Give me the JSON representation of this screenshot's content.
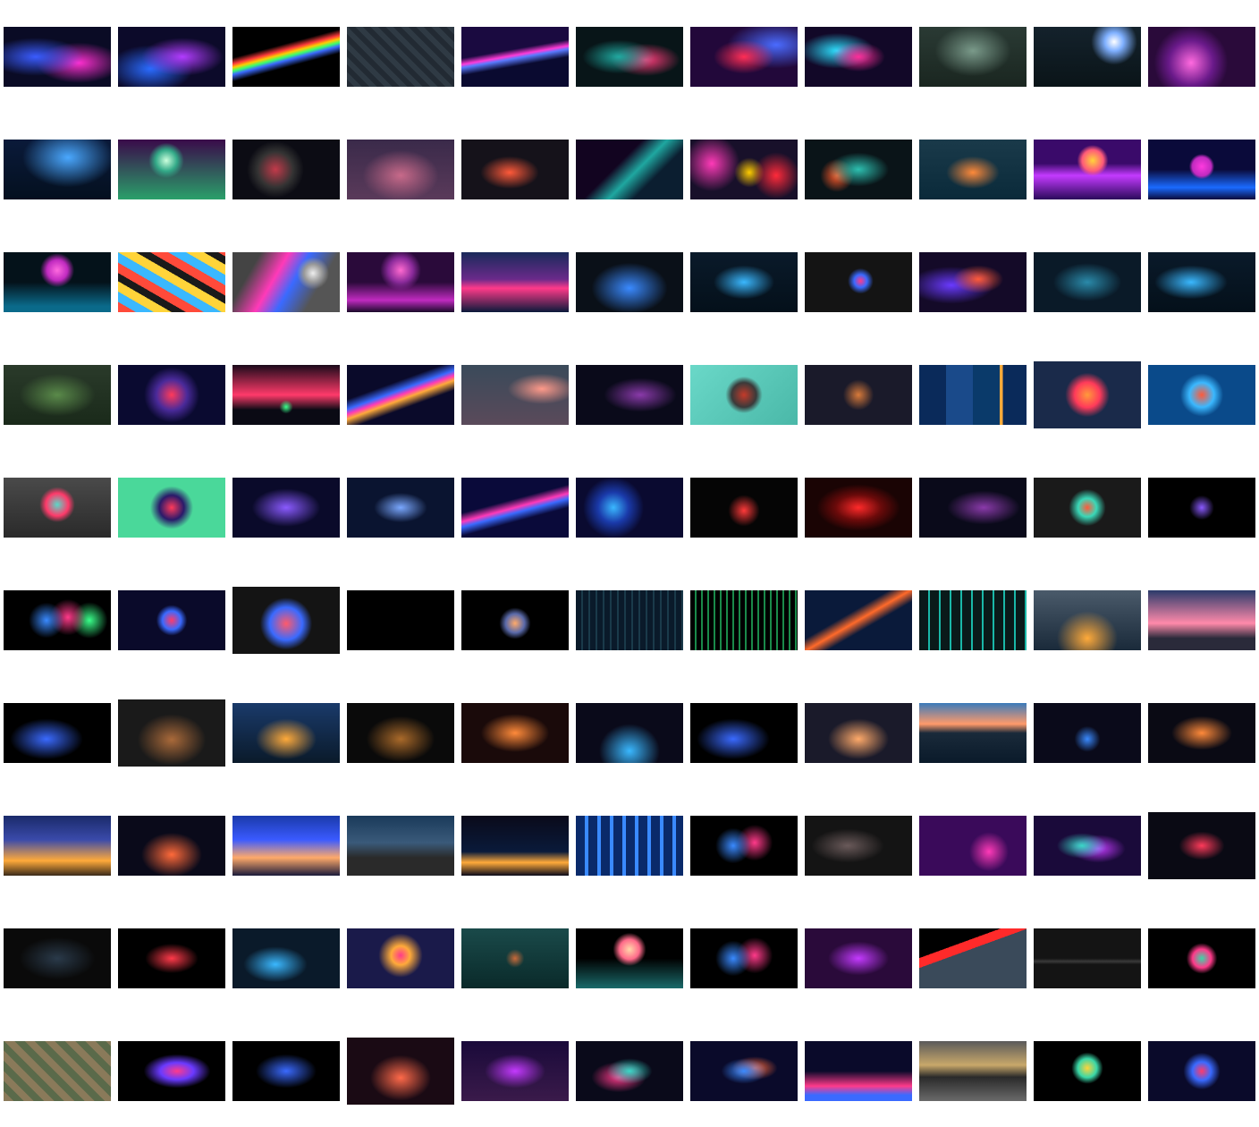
{
  "gallery": {
    "rows": [
      [
        {
          "bg": "radial-gradient(ellipse at 30% 50%, #3a5cff 0%, transparent 45%), radial-gradient(ellipse at 70% 60%, #ff2fd0 0%, transparent 40%), #0a0b25"
        },
        {
          "bg": "radial-gradient(ellipse at 60% 50%, #b23cff 0%, transparent 45%), radial-gradient(ellipse at 30% 70%, #2a6bff 0%, transparent 40%), #0c0a2a"
        },
        {
          "bg": "linear-gradient(165deg, #000 35%, #ff3b3b 42%, #ffcc00 46%, #3bff6b 50%, #3b6bff 54%, #000 62%)"
        },
        {
          "bg": "repeating-linear-gradient(45deg, #222a33 0 6px, #2f3a44 6px 12px), #222"
        },
        {
          "bg": "linear-gradient(170deg, #1a0a40 40%, #ff3bd8 48%, #5a7bff 52%, #0a0a30 62%)"
        },
        {
          "bg": "radial-gradient(ellipse at 40% 50%, #1fa9a0 0%, transparent 40%), radial-gradient(ellipse at 65% 55%, #ff3b7a 0%, transparent 35%), #081518"
        },
        {
          "bg": "radial-gradient(ellipse at 50% 50%, #ff2d55 0%, transparent 40%), radial-gradient(ellipse at 80% 30%, #4a6bff 0%, transparent 40%), #22083a"
        },
        {
          "bg": "radial-gradient(ellipse at 50% 50%, #ff2d9a 0%, transparent 35%), radial-gradient(ellipse at 30% 40%, #2de0ff 0%, transparent 35%), #120828"
        },
        {
          "bg": "radial-gradient(ellipse at 50% 40%, #7a9a8a 0%, transparent 50%), linear-gradient(#2a3a34, #1a2620)"
        },
        {
          "bg": "radial-gradient(circle at 75% 25%, #ffffff 0%, #7fb0ff 10%, transparent 25%), linear-gradient(#14222c, #0a1418)"
        },
        {
          "bg": "radial-gradient(circle at 40% 60%, #ff6adf 0%, #6a1a8a 30%, transparent 50%), #2a0a3a"
        }
      ],
      [
        {
          "bg": "radial-gradient(ellipse at 60% 30%, #4aa8ff 0%, transparent 50%), linear-gradient(#0a1a3a, #04101f)"
        },
        {
          "bg": "radial-gradient(circle at 45% 35%, #cfd 0%, #3a8 15%, transparent 25%), linear-gradient(#3a0a4a, #2aa06a)"
        },
        {
          "bg": "radial-gradient(circle at 40% 50%, #c23a4a 0%, #333 25%, transparent 40%), #0c0c14"
        },
        {
          "bg": "radial-gradient(ellipse at 50% 60%, #c86a8a 0%, transparent 50%), linear-gradient(#3a2a4a, #5a3a5a)"
        },
        {
          "bg": "radial-gradient(ellipse at 45% 55%, #ff5a3a 0%, transparent 35%), #15121a"
        },
        {
          "bg": "linear-gradient(135deg, #120420 40%, #1fa7a0 55%, #0b1e30 70%), radial-gradient(circle at 25% 30%, #ff3a3a 0%, transparent 30%)"
        },
        {
          "bg": "radial-gradient(circle at 80% 60%, #ff2a3a 0%, transparent 25%), radial-gradient(circle at 55% 55%, #ffcc00 0%, transparent 22%), radial-gradient(circle at 20% 40%, #ff3ab8 0%, transparent 30%), #18102a"
        },
        {
          "bg": "radial-gradient(ellipse at 50% 50%, #2dbfb0 0%, transparent 40%), radial-gradient(circle at 30% 60%, #ff5a2a 0%, transparent 20%), #0a1418"
        },
        {
          "bg": "radial-gradient(ellipse at 50% 55%, #ff8a3a 0%, transparent 35%), linear-gradient(#1a3a4a, #0a2a3a)"
        },
        {
          "bg": "radial-gradient(circle at 55% 35%, #ffd43a 0%, #ff5a7a 15%, transparent 22%), linear-gradient(#3a0a6a 40%, #c43aff 60%, #2a0a5a)"
        },
        {
          "bg": "radial-gradient(circle at 50% 45%, #ff3adf 0%, #c02ac0 15%, transparent 20%), linear-gradient(#0a0a3a 50%, #1a6aff 80%, #0a0a3a)"
        }
      ],
      [
        {
          "bg": "radial-gradient(circle at 50% 30%, #ff6adf 0%, #c02ac0 15%, transparent 25%), linear-gradient(#04121a 50%, #0a6a8a 90%)"
        },
        {
          "bg": "repeating-linear-gradient(30deg, #ff4a3a 0 10px, #3ab8ff 10px 20px, #ffd43a 20px 30px, #1a1a1a 30px 38px)"
        },
        {
          "bg": "radial-gradient(circle at 75% 35%, #eee 0%, #999 10%, transparent 18%), linear-gradient(120deg, #444 20%, #ff3ab8 40%, #3a6aff 55%, #555 75%)"
        },
        {
          "bg": "radial-gradient(circle at 50% 30%, #ff6ad0 0%, #8a2a9a 18%, transparent 30%), linear-gradient(#2a0a3a 50%, #c02ac0 80%, #1a0a2a)"
        },
        {
          "bg": "linear-gradient(#1a2a5a 0%, #6a2a8a 45%, #ff3a8a 60%, #0a1a3a 100%)"
        },
        {
          "bg": "radial-gradient(ellipse at 50% 60%, #3a8aff 0%, transparent 50%), #0a1018"
        },
        {
          "bg": "radial-gradient(ellipse at 50% 50%, #3ab8ff 0%, transparent 40%), linear-gradient(#0a1a2a, #04101a)"
        },
        {
          "bg": "radial-gradient(circle at 52% 48%, #ff3a8a 0%, #3a6aff 10%, transparent 20%), #141414"
        },
        {
          "bg": "radial-gradient(ellipse at 55% 45%, #ff5a3a 0%, transparent 30%), radial-gradient(ellipse at 30% 55%, #6a3aff 0%, transparent 40%), #140a28"
        },
        {
          "bg": "radial-gradient(ellipse at 50% 50%, #2a8aaa 0%, transparent 45%), #0a1a28"
        },
        {
          "bg": "radial-gradient(ellipse at 40% 50%, #3ab8ff 0%, transparent 40%), linear-gradient(#0a1a2a, #04101a)"
        }
      ],
      [
        {
          "bg": "radial-gradient(ellipse at 50% 50%, #5a8a4a 0%, transparent 50%), linear-gradient(#2a3a2a, #1a2a1a)"
        },
        {
          "bg": "radial-gradient(circle at 50% 50%, #ff3a5a 0%, #4a2a9a 25%, transparent 45%), #0a0a30"
        },
        {
          "bg": "radial-gradient(circle at 50% 70%, #3aff8a 0%, transparent 10%), linear-gradient(#1a0a1a 0%, #ff3a6a 50%, #0a0a14 75%)"
        },
        {
          "bg": "linear-gradient(160deg, #0a0a2a 35%, #3a6aff 45%, #ff3ab8 50%, #ffaa3a 55%, #0a0a2a 65%)"
        },
        {
          "bg": "radial-gradient(ellipse at 75% 40%, #ff9a8a 0%, transparent 30%), linear-gradient(#3a4a5a, #5a4a5a)"
        },
        {
          "bg": "radial-gradient(ellipse at 60% 50%, #8a3aaa 0%, transparent 40%), #0a0a1a"
        },
        {
          "bg": "radial-gradient(circle at 50% 50%, #c43a2a 0%, #3a3a3a 20%, transparent 30%), linear-gradient(135deg, #6ad8c8, #4ab8a8)"
        },
        {
          "bg": "radial-gradient(circle at 50% 50%, #d87a3a 0%, transparent 25%), #1a1a2a"
        },
        {
          "bg": "linear-gradient(90deg, #0a2a5a 0 25%, #1a4a8a 25% 50%, #0a3a6a 50% 75%, #ffaa3a 75% 78%, #0a2a5a 78%)"
        },
        {
          "bg": "radial-gradient(circle at 50% 50%, #ff9a3a 0%, #ff3a5a 20%, transparent 35%), #1a2a4a",
          "tall": true
        },
        {
          "bg": "radial-gradient(circle at 50% 50%, #ff5a3a 0%, #3ab8ff 20%, transparent 35%), #0a4a8a"
        }
      ],
      [
        {
          "bg": "radial-gradient(circle at 50% 45%, #5ad8c8 0%, #ff3a6a 18%, transparent 28%), linear-gradient(#4a4a4a, #2a2a2a)"
        },
        {
          "bg": "radial-gradient(circle at 50% 50%, #ff3a5a 0%, #2a1a6a 20%, transparent 35%), #4ad89a"
        },
        {
          "bg": "radial-gradient(ellipse at 50% 50%, #8a5aff 0%, transparent 45%), #0a0a2a"
        },
        {
          "bg": "radial-gradient(ellipse at 50% 50%, #7aa8ff 0%, transparent 35%), #0a1430"
        },
        {
          "bg": "linear-gradient(165deg, #0a0a3a 40%, #ff3ab8 50%, #3a6aff 56%, #0a0a3a 66%)"
        },
        {
          "bg": "radial-gradient(circle at 35% 50%, #3ab8ff 0%, #1a3aaa 20%, transparent 40%), #0a0a30"
        },
        {
          "bg": "radial-gradient(circle at 50% 55%, #ff3a3a 0%, transparent 25%), #050505"
        },
        {
          "bg": "radial-gradient(ellipse at 50% 50%, #ff2a2a 0%, #6a0a0a 30%, transparent 55%), #1a0404"
        },
        {
          "bg": "radial-gradient(ellipse at 60% 50%, #8a3aaa 0%, transparent 40%), #0a0a1a"
        },
        {
          "bg": "radial-gradient(circle at 50% 50%, #ff5a3a 0%, #3ad8b8 15%, transparent 30%), #1a1a1a"
        },
        {
          "bg": "radial-gradient(circle at 50% 50%, #8a5aff 0%, transparent 20%), #000"
        }
      ],
      [
        {
          "bg": "radial-gradient(circle at 40% 50%, #3a8aff 0%, transparent 25%), radial-gradient(circle at 60% 45%, #ff3a8a 0%, transparent 25%), radial-gradient(circle at 80% 50%, #3aff8a 0%, transparent 20%), #000"
        },
        {
          "bg": "radial-gradient(circle at 50% 50%, #ff3a6a 0%, #3a6aff 15%, transparent 25%), #0a0a2a"
        },
        {
          "bg": "radial-gradient(circle at 50% 55%, #ff5a6a 0%, #3a6aff 25%, transparent 40%), #141414",
          "tall": true
        },
        {
          "bg": "#000000"
        },
        {
          "bg": "radial-gradient(circle at 50% 55%, #ffaa6a 0%, #5a6aaa 15%, transparent 25%), #000"
        },
        {
          "bg": "repeating-linear-gradient(90deg, #0a1a2a 0 6px, #1a3a4a 6px 8px), #0a1a2a"
        },
        {
          "bg": "repeating-linear-gradient(90deg, #000 0 5px, #1a8a4a 5px 7px), #000"
        },
        {
          "bg": "linear-gradient(150deg, #0a1a3a 40%, #ff6a2a 50%, #0a1a3a 60%)"
        },
        {
          "bg": "repeating-linear-gradient(90deg, #0a1a1a 0 10px, #1ab8a8 10px 12px), #0a1a1a"
        },
        {
          "bg": "radial-gradient(ellipse at 50% 80%, #ffaa3a 0%, transparent 40%), linear-gradient(#4a5a6a, #1a2a3a)"
        },
        {
          "bg": "linear-gradient(#2a3a6a 0%, #ff8aaa 55%, #2a2a3a 80%)"
        }
      ],
      [
        {
          "bg": "radial-gradient(ellipse at 40% 60%, #3a6aff 0%, transparent 40%), #000"
        },
        {
          "bg": "radial-gradient(ellipse at 50% 60%, #aa6a3a 0%, transparent 45%), #1a1a1a",
          "tall": true
        },
        {
          "bg": "radial-gradient(ellipse at 50% 60%, #ffaa3a 0%, transparent 40%), linear-gradient(#1a3a6a, #0a1a2a)"
        },
        {
          "bg": "radial-gradient(ellipse at 50% 60%, #aa6a2a 0%, transparent 45%), #0a0a0a"
        },
        {
          "bg": "radial-gradient(ellipse at 50% 50%, #ff8a3a 0%, transparent 45%), #1a0a0a"
        },
        {
          "bg": "radial-gradient(ellipse at 50% 80%, #3ab8ff 0%, transparent 40%), #0a0a1a"
        },
        {
          "bg": "radial-gradient(ellipse at 40% 60%, #3a6aff 0%, transparent 40%), #000"
        },
        {
          "bg": "radial-gradient(ellipse at 50% 60%, #ffaa6a 0%, transparent 40%), #1a1a2a"
        },
        {
          "bg": "linear-gradient(#3a7aba 0%, #ff9a6a 35%, #1a2a3a 50%, #0a1a2a)"
        },
        {
          "bg": "radial-gradient(circle at 50% 60%, #3a8aff 0%, transparent 20%), #0a0a1a"
        },
        {
          "bg": "radial-gradient(ellipse at 50% 50%, #ff8a3a 0%, transparent 40%), #0a0a14"
        }
      ],
      [
        {
          "bg": "linear-gradient(#1a2a6a 0%, #3a4aaa 40%, #ffaa3a 75%, #3a2a1a)"
        },
        {
          "bg": "radial-gradient(ellipse at 50% 65%, #ff6a3a 0%, transparent 40%), #0a0a1a"
        },
        {
          "bg": "linear-gradient(#1a3aaa 0%, #3a5aff 40%, #ffaa6a 70%, #1a1a3a)"
        },
        {
          "bg": "linear-gradient(#1a3a5a 0%, #3a5a7a 45%, #2a2a2a 70%)"
        },
        {
          "bg": "linear-gradient(#0a0a1a 0%, #0a1a3a 60%, #ffaa3a 78%, #0a0a1a)"
        },
        {
          "bg": "repeating-linear-gradient(90deg, #0a2a6a 0 10px, #3a8aff 10px 14px), #0a2a6a"
        },
        {
          "bg": "radial-gradient(circle at 40% 50%, #3a8aff 0%, transparent 25%), radial-gradient(circle at 60% 45%, #ff3a8a 0%, transparent 25%), #000"
        },
        {
          "bg": "radial-gradient(ellipse at 40% 50%, #6a5a5a 0%, transparent 40%), #141414"
        },
        {
          "bg": "radial-gradient(circle at 65% 60%, #ff3ab8 0%, transparent 25%), #3a0a5a"
        },
        {
          "bg": "radial-gradient(ellipse at 45% 50%, #3ad8c8 0%, transparent 30%), radial-gradient(ellipse at 60% 55%, #c43aff 0%, transparent 30%), #1a0a3a"
        },
        {
          "bg": "radial-gradient(ellipse at 50% 50%, #ff3a5a 0%, transparent 30%), #0a0a14",
          "tall": true
        }
      ],
      [
        {
          "bg": "radial-gradient(ellipse at 50% 50%, #2a3a4a 0%, transparent 50%), #0a0a0a"
        },
        {
          "bg": "radial-gradient(ellipse at 50% 50%, #ff3a4a 0%, transparent 35%), #000"
        },
        {
          "bg": "radial-gradient(ellipse at 40% 60%, #3ab8ff 0%, transparent 35%), #0a1a2a"
        },
        {
          "bg": "radial-gradient(circle at 50% 45%, #ff3a8a 0%, #ffaa3a 15%, transparent 35%), #1a1a4a"
        },
        {
          "bg": "radial-gradient(circle at 50% 50%, #c86a3a 0%, transparent 15%), linear-gradient(#1a4a4a, #0a2a2a)"
        },
        {
          "bg": "radial-gradient(circle at 50% 35%, #ffd8aa 0%, #ff6a8a 15%, transparent 25%), linear-gradient(#000 50%, #1a6a6a 100%)"
        },
        {
          "bg": "radial-gradient(circle at 40% 50%, #3a8aff 0%, transparent 25%), radial-gradient(circle at 60% 45%, #ff3a8a 0%, transparent 25%), #000"
        },
        {
          "bg": "radial-gradient(ellipse at 50% 50%, #c43aff 0%, transparent 40%), #2a0a3a"
        },
        {
          "bg": "linear-gradient(160deg, #000 30%, #ff2a2a 30% 40%, #3a4a5a 40%)"
        },
        {
          "bg": "linear-gradient(#141414 50%, #3a3a3a 55%, #141414 60%)"
        },
        {
          "bg": "radial-gradient(circle at 50% 50%, #3ad8a8 0%, #ff3a8a 15%, transparent 25%), #000"
        }
      ],
      [
        {
          "bg": "repeating-linear-gradient(45deg, #8a7a5a 0 8px, #5a6a4a 8px 16px), #6a6a5a"
        },
        {
          "bg": "radial-gradient(ellipse at 55% 50%, #ff3a8a 0%, #6a3aff 20%, transparent 40%), #000"
        },
        {
          "bg": "radial-gradient(ellipse at 50% 50%, #3a6aff 0%, transparent 40%), #000"
        },
        {
          "bg": "radial-gradient(ellipse at 50% 60%, #ff6a4a 0%, transparent 40%), #1a0a14",
          "tall": true
        },
        {
          "bg": "radial-gradient(ellipse at 50% 50%, #c43aff 0%, transparent 40%), linear-gradient(#1a0a3a, #3a1a4a)"
        },
        {
          "bg": "radial-gradient(ellipse at 50% 50%, #3ad8c8 0%, transparent 30%), radial-gradient(ellipse at 40% 60%, #ff3a8a 0%, transparent 30%), #0a0a1a"
        },
        {
          "bg": "radial-gradient(ellipse at 50% 50%, #3a8aff 0%, transparent 30%), radial-gradient(ellipse at 60% 45%, #ff6a3a 0%, transparent 25%), #0a0a2a"
        },
        {
          "bg": "linear-gradient(#0a0a2a 50%, #ff3a8a 75%, #3a6aff 90%)"
        },
        {
          "bg": "linear-gradient(#5a5a5a 0%, #c8a86a 40%, #2a2a2a 60%, #6a6a6a)"
        },
        {
          "bg": "radial-gradient(circle at 50% 45%, #ffd43a 0%, #3ad8a8 15%, transparent 25%), #000"
        },
        {
          "bg": "radial-gradient(circle at 50% 50%, #ff3a6a 0%, #3a6aff 15%, transparent 30%), #0a0a2a"
        }
      ]
    ]
  }
}
